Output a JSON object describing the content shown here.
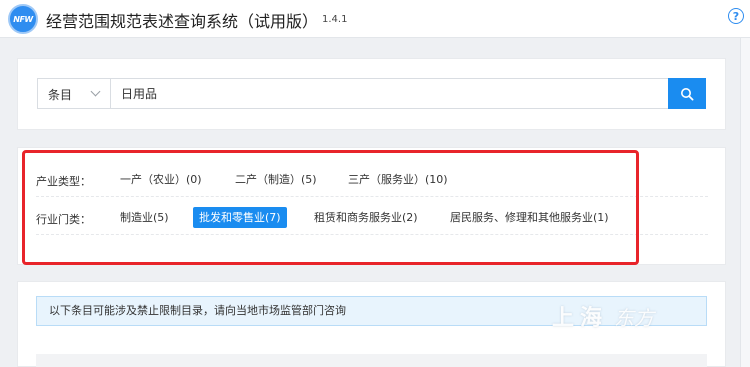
{
  "app": {
    "logo_text": "NFW",
    "title": "经营范围规范表述查询系统（试用版）",
    "version": "1.4.1",
    "help_symbol": "?"
  },
  "search": {
    "type_label": "条目",
    "query": "日用品"
  },
  "filters": {
    "industry_type": {
      "label": "产业类型：",
      "options": [
        "一产（农业）(0)",
        "二产（制造）(5)",
        "三产（服务业）(10)"
      ]
    },
    "industry_category": {
      "label": "行业门类：",
      "options": [
        "制造业(5)",
        "批发和零售业(7)",
        "租赁和商务服务业(2)",
        "居民服务、修理和其他服务业(1)"
      ],
      "selected": "批发和零售业(7)"
    }
  },
  "notice": {
    "text": "以下条目可能涉及禁止限制目录，请向当地市场监管部门咨询"
  },
  "watermark": {
    "text": "上海",
    "seal": "东方"
  },
  "colors": {
    "accent": "#1a8cf0",
    "highlight": "#e8242a",
    "notice_bg": "#e8f4fd"
  }
}
